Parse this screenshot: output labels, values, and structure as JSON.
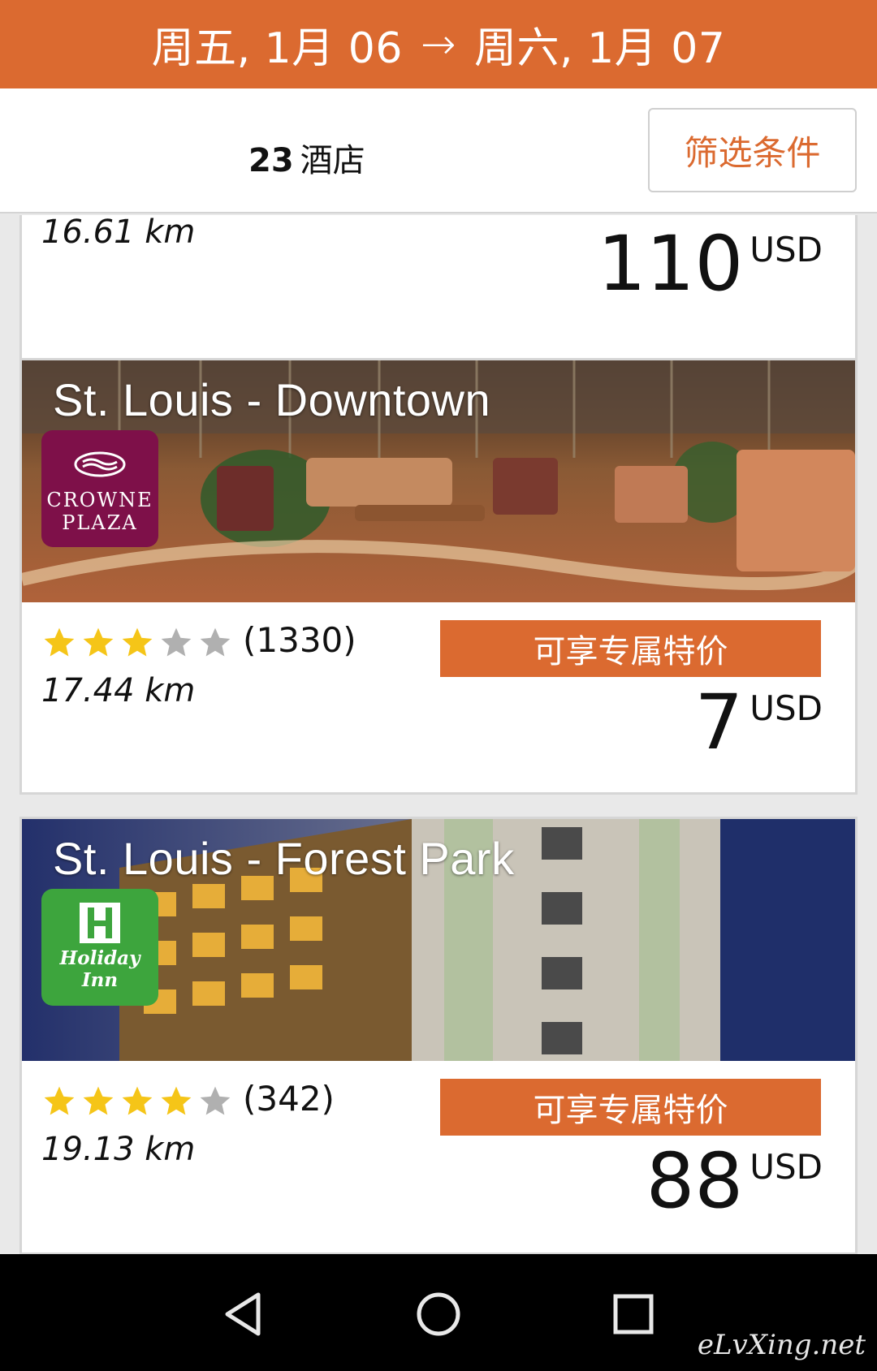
{
  "header": {
    "check_in": "周五, 1月 06",
    "arrow": "→",
    "check_out": "周六, 1月 07"
  },
  "toolbar": {
    "count": "23",
    "count_unit": "酒店",
    "filter_label": "筛选条件"
  },
  "colors": {
    "accent": "#db6a30",
    "star_filled": "#f5c518",
    "star_empty": "#b0b0b0"
  },
  "hotels": [
    {
      "distance": "16.61 km",
      "price": "110",
      "currency": "USD"
    },
    {
      "name": "St. Louis - Downtown",
      "brand": "crowne-plaza",
      "brand_line1": "CROWNE",
      "brand_line2": "PLAZA",
      "rating": 3,
      "max_rating": 5,
      "reviews": "(1330)",
      "distance": "17.44 km",
      "deal_label": "可享专属特价",
      "price": "7",
      "currency": "USD"
    },
    {
      "name": "St. Louis - Forest Park",
      "brand": "holiday-inn",
      "brand_line1": "Holiday Inn",
      "rating": 4,
      "max_rating": 5,
      "reviews": "(342)",
      "distance": "19.13 km",
      "deal_label": "可享专属特价",
      "price": "88",
      "currency": "USD"
    }
  ],
  "system_nav": {
    "back": "back-icon",
    "home": "home-icon",
    "recent": "recent-apps-icon"
  },
  "watermark": "eLvXing.net"
}
